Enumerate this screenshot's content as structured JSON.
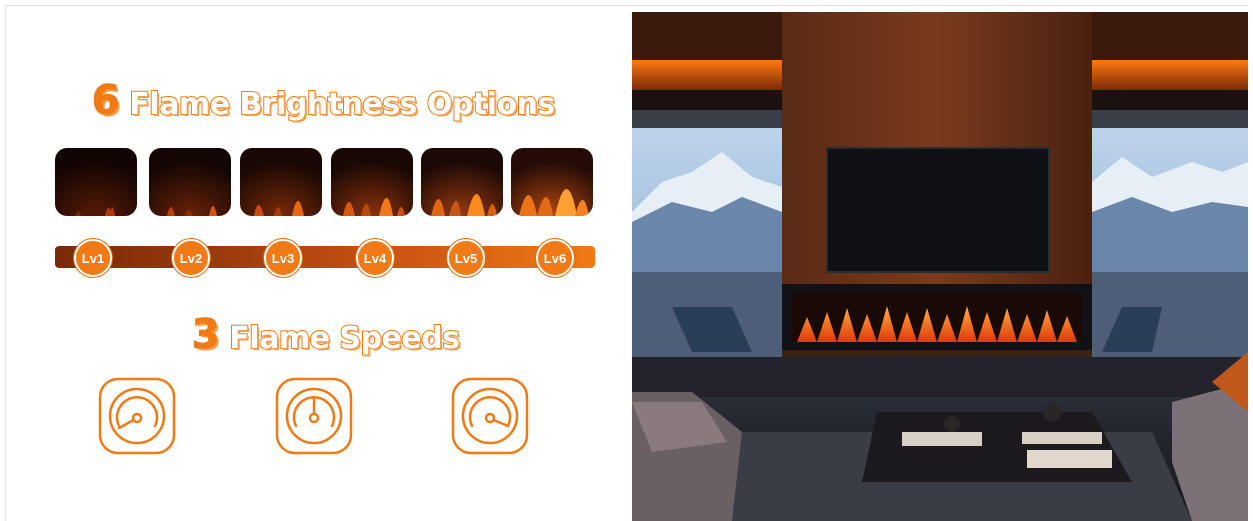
{
  "brightness": {
    "count": "6",
    "title": "Flame Brightness Options",
    "levels": [
      "Lv1",
      "Lv2",
      "Lv3",
      "Lv4",
      "Lv5",
      "Lv6"
    ]
  },
  "speeds": {
    "count": "3",
    "title": "Flame Speeds",
    "icons": [
      "gauge-slow-icon",
      "gauge-medium-icon",
      "gauge-fast-icon"
    ]
  },
  "colors": {
    "accent": "#f07a16",
    "bar_dark": "#7a2a08"
  }
}
